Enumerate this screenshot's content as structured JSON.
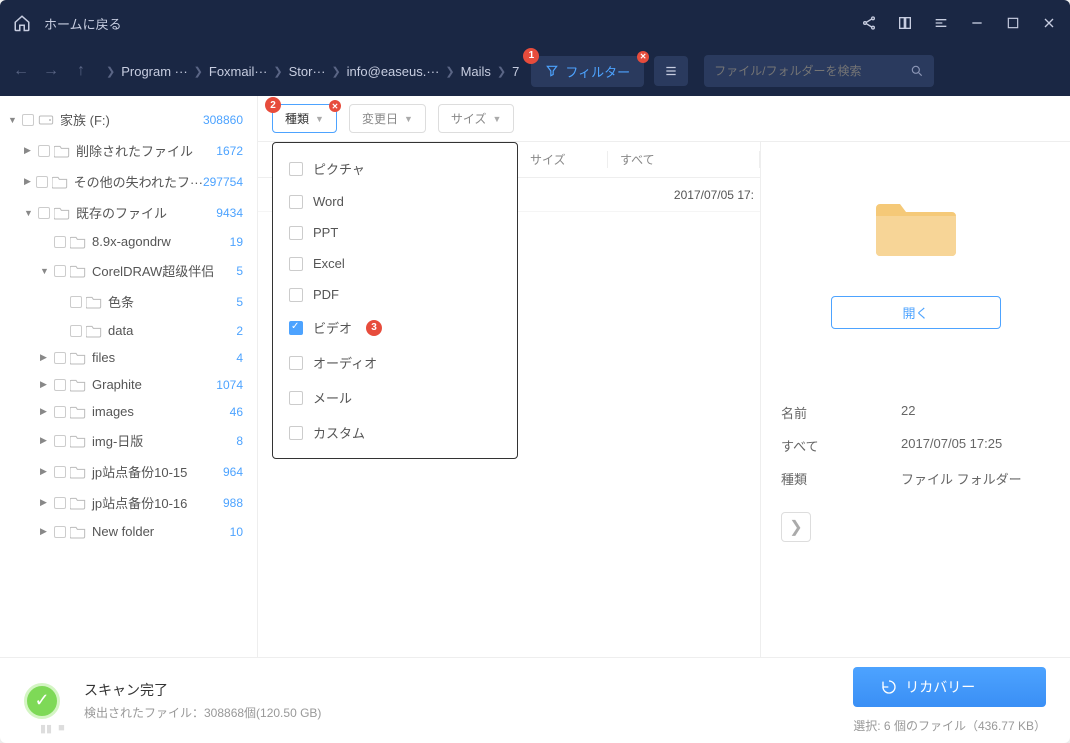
{
  "titlebar": {
    "home_label": "ホームに戻る"
  },
  "breadcrumb": [
    "Program ···",
    "Foxmail···",
    "Stor···",
    "info@easeus.···",
    "Mails",
    "7"
  ],
  "topbar": {
    "filter_label": "フィルター",
    "search_placeholder": "ファイル/フォルダーを検索"
  },
  "filter_pills": {
    "type": "種類",
    "date": "変更日",
    "size": "サイズ"
  },
  "type_options": [
    {
      "label": "ピクチャ",
      "checked": false
    },
    {
      "label": "Word",
      "checked": false
    },
    {
      "label": "PPT",
      "checked": false
    },
    {
      "label": "Excel",
      "checked": false
    },
    {
      "label": "PDF",
      "checked": false
    },
    {
      "label": "ビデオ",
      "checked": true
    },
    {
      "label": "オーディオ",
      "checked": false
    },
    {
      "label": "メール",
      "checked": false
    },
    {
      "label": "カスタム",
      "checked": false
    }
  ],
  "badges": {
    "filter": "1",
    "type": "2",
    "video": "3"
  },
  "table": {
    "col_size": "サイズ",
    "col_all": "すべて",
    "row_date": "2017/07/05 17:"
  },
  "sidebar": [
    {
      "level": 0,
      "toggle": "▼",
      "drive": true,
      "label": "家族 (F:)",
      "count": "308860"
    },
    {
      "level": 1,
      "toggle": "▶",
      "label": "削除されたファイル",
      "count": "1672"
    },
    {
      "level": 1,
      "toggle": "▶",
      "label": "その他の失われたフ···",
      "count": "297754"
    },
    {
      "level": 1,
      "toggle": "▼",
      "label": "既存のファイル",
      "count": "9434"
    },
    {
      "level": 2,
      "toggle": "",
      "label": "8.9x-agondrw",
      "count": "19"
    },
    {
      "level": 2,
      "toggle": "▼",
      "label": "CorelDRAW超级伴侣",
      "count": "5"
    },
    {
      "level": 3,
      "toggle": "",
      "label": "色条",
      "count": "5"
    },
    {
      "level": 3,
      "toggle": "",
      "label": "data",
      "count": "2"
    },
    {
      "level": 2,
      "toggle": "▶",
      "label": "files",
      "count": "4"
    },
    {
      "level": 2,
      "toggle": "▶",
      "label": "Graphite",
      "count": "1074"
    },
    {
      "level": 2,
      "toggle": "▶",
      "label": "images",
      "count": "46"
    },
    {
      "level": 2,
      "toggle": "▶",
      "label": "img-日版",
      "count": "8"
    },
    {
      "level": 2,
      "toggle": "▶",
      "label": "jp站点备份10-15",
      "count": "964"
    },
    {
      "level": 2,
      "toggle": "▶",
      "label": "jp站点备份10-16",
      "count": "988"
    },
    {
      "level": 2,
      "toggle": "▶",
      "label": "New folder",
      "count": "10"
    }
  ],
  "details": {
    "open_btn": "開く",
    "name_label": "名前",
    "name_value": "22",
    "all_label": "すべて",
    "all_value": "2017/07/05 17:25",
    "type_label": "種類",
    "type_value": "ファイル フォルダー"
  },
  "footer": {
    "status": "スキャン完了",
    "status_sub": "検出されたファイル：308868個(120.50 GB)",
    "recovery": "リカバリー",
    "selection": "選択: 6 個のファイル（436.77 KB）"
  }
}
